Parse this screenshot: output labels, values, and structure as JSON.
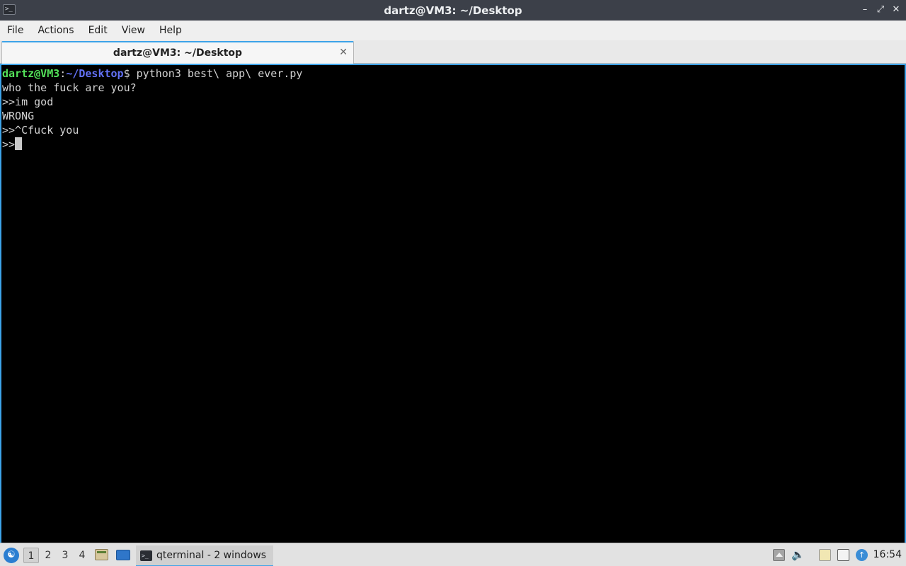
{
  "window": {
    "title": "dartz@VM3: ~/Desktop",
    "icons": [
      "terminal-icon",
      "minimize-icon",
      "maximize-icon",
      "close-icon"
    ]
  },
  "menubar": {
    "items": [
      "File",
      "Actions",
      "Edit",
      "View",
      "Help"
    ]
  },
  "tabs": [
    {
      "label": "dartz@VM3: ~/Desktop",
      "active": true
    }
  ],
  "terminal": {
    "prompt_user": "dartz@VM3",
    "prompt_sep": ":",
    "prompt_path": "~/Desktop",
    "prompt_end": "$",
    "command": " python3 best\\ app\\ ever.py",
    "lines": [
      "who the fuck are you?",
      ">>im god",
      "WRONG",
      ">>^Cfuck you",
      ">>"
    ],
    "colors": {
      "background": "#000000",
      "text": "#d2d2d2",
      "prompt_user": "#54e35a",
      "prompt_path": "#6271f5"
    }
  },
  "taskbar": {
    "desktops": [
      "1",
      "2",
      "3",
      "4"
    ],
    "active_desktop": "1",
    "task_label": "qterminal - 2 windows",
    "clock": "16:54",
    "accent": "#3da3e8"
  }
}
